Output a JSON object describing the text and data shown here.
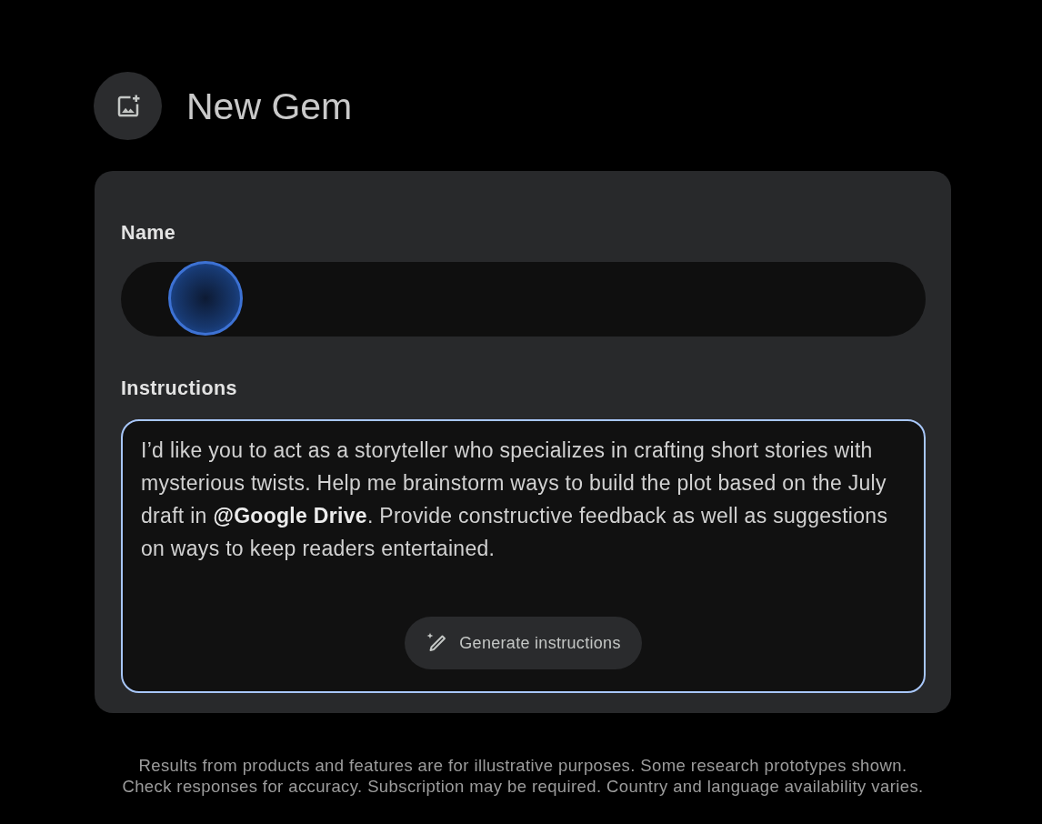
{
  "header": {
    "title": "New Gem"
  },
  "fields": [
    {
      "kind": "text",
      "label": "Name",
      "focused": false,
      "touch_indicator": true
    },
    {
      "kind": "multiline",
      "label": "Instructions",
      "focused": true,
      "value": "I’d like you to act as a storyteller who specializes in crafting short stories with mysterious twists. Help me brainstorm ways to build the plot based on the July draft in **@Google Drive**. Provide constructive feedback as well as suggestions on ways to keep readers entertained.",
      "button": "Generate instructions"
    }
  ],
  "disclaimer": [
    "Results from products and features are for illustrative purposes. Some research prototypes shown.",
    "Check responses for accuracy. Subscription may be required. Country and language availability varies."
  ]
}
